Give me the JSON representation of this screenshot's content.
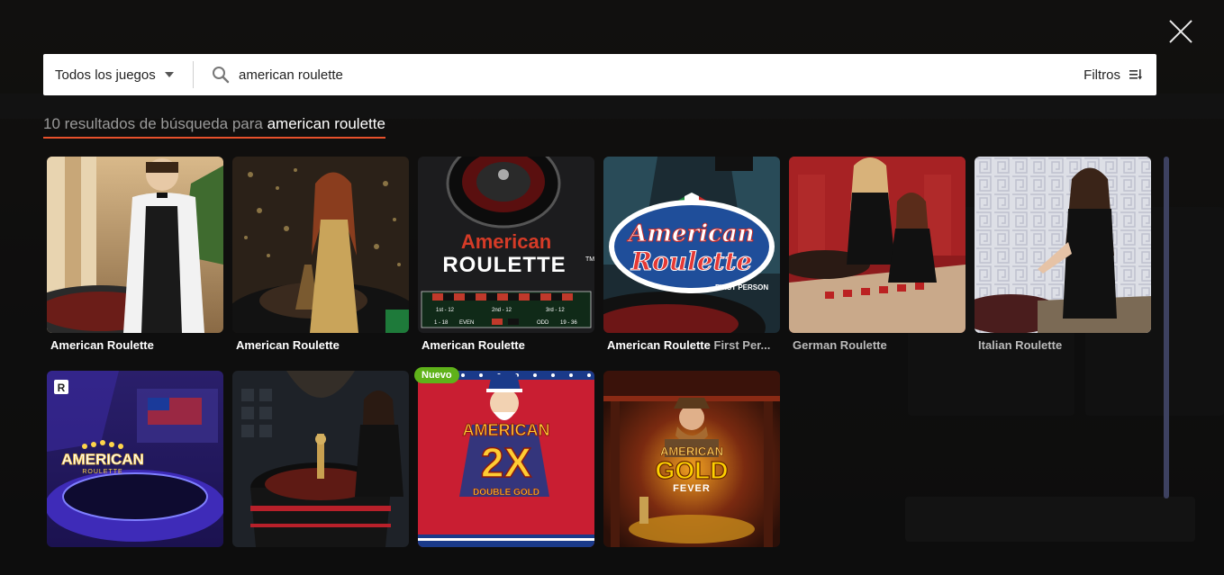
{
  "search": {
    "category_label": "Todos los juegos",
    "query": "american roulette",
    "filters_label": "Filtros"
  },
  "results": {
    "prefix": "10 resultados de búsqueda para",
    "query": "american roulette"
  },
  "badges": {
    "new_label": "Nuevo"
  },
  "games": [
    {
      "title": "American Roulette",
      "subtitle": ""
    },
    {
      "title": "American Roulette",
      "subtitle": ""
    },
    {
      "title": "American Roulette",
      "subtitle": ""
    },
    {
      "title": "American Roulette",
      "subtitle": "First Per..."
    },
    {
      "title": "German Roulette",
      "subtitle": ""
    },
    {
      "title": "Italian Roulette",
      "subtitle": ""
    }
  ],
  "thumb_text": {
    "t3_line1": "American",
    "t3_line2": "ROULETTE",
    "t3_tm": "TM",
    "t3_cells": [
      "1st - 12",
      "2nd - 12",
      "3rd - 12",
      "1 - 18",
      "EVEN",
      "ODD",
      "19 - 36"
    ],
    "t4_line1": "American",
    "t4_line2": "Roulette",
    "t4_sub": "FIRST PERSON",
    "t7_logo": "R",
    "t7_line1": "AMERICAN",
    "t7_line2": "ROULETTE",
    "t9_line1": "AMERICAN",
    "t9_line2": "2X",
    "t9_line3": "DOUBLE GOLD",
    "t10_line1": "AMERICAN",
    "t10_line2": "GOLD",
    "t10_line3": "FEVER"
  },
  "colors": {
    "accent": "#e8512b",
    "new_badge": "#5fb21a",
    "scrollbar": "#3d4160"
  }
}
